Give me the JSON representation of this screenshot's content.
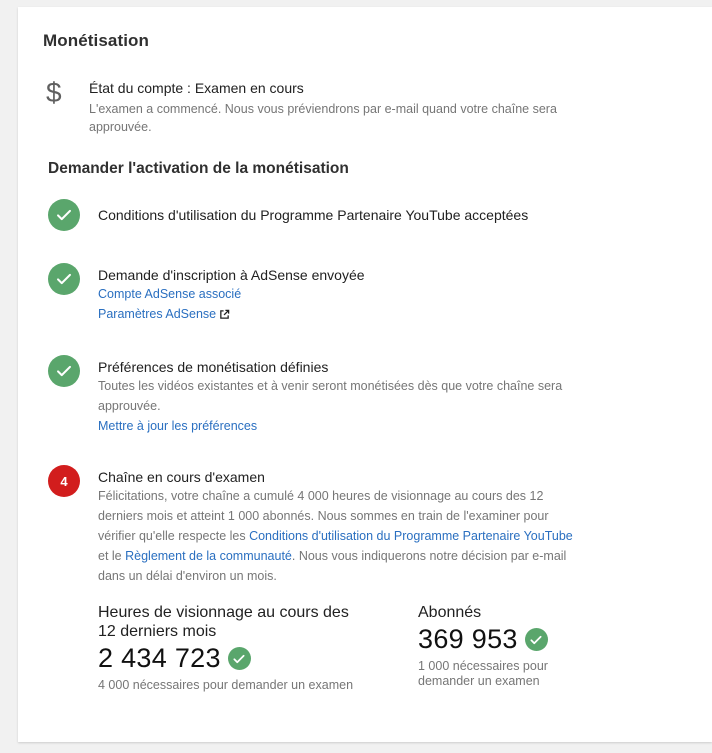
{
  "card": {
    "title": "Monétisation",
    "status_icon": "dollar-icon",
    "status_title": "État du compte : Examen en cours",
    "status_desc": "L'examen a commencé. Nous vous préviendrons par e-mail quand votre chaîne sera approuvée."
  },
  "section": {
    "title": "Demander l'activation de la monétisation"
  },
  "steps": [
    {
      "state": "done",
      "title": "Conditions d'utilisation du Programme Partenaire YouTube acceptées"
    },
    {
      "state": "done",
      "title": "Demande d'inscription à AdSense envoyée",
      "link1": "Compte AdSense associé",
      "link2": "Paramètres AdSense"
    },
    {
      "state": "done",
      "title": "Préférences de monétisation définies",
      "desc": "Toutes les vidéos existantes et à venir seront monétisées dès que votre chaîne sera approuvée.",
      "link1": "Mettre à jour les préférences"
    },
    {
      "state": "pending",
      "number": "4",
      "title": "Chaîne en cours d'examen",
      "desc_part1": "Félicitations, votre chaîne a cumulé 4 000 heures de visionnage au cours des 12 derniers mois et atteint 1 000 abonnés. Nous sommes en train de l'examiner pour vérifier qu'elle respecte les ",
      "desc_link1": "Conditions d'utilisation du Programme Partenaire YouTube",
      "desc_part2": " et le ",
      "desc_link2": "Règlement de la communauté",
      "desc_part3": ". Nous vous indiquerons notre décision par e-mail dans un délai d'environ un mois."
    }
  ],
  "metrics": {
    "watch_hours": {
      "label": "Heures de visionnage au cours des 12 derniers mois",
      "value": "2 434 723",
      "note": "4 000 nécessaires pour demander un examen"
    },
    "subscribers": {
      "label": "Abonnés",
      "value": "369 953",
      "note": "1 000 nécessaires pour demander un examen"
    }
  },
  "colors": {
    "success": "#5aa66c",
    "pending": "#d21d1d",
    "link": "#2a6fc0"
  }
}
